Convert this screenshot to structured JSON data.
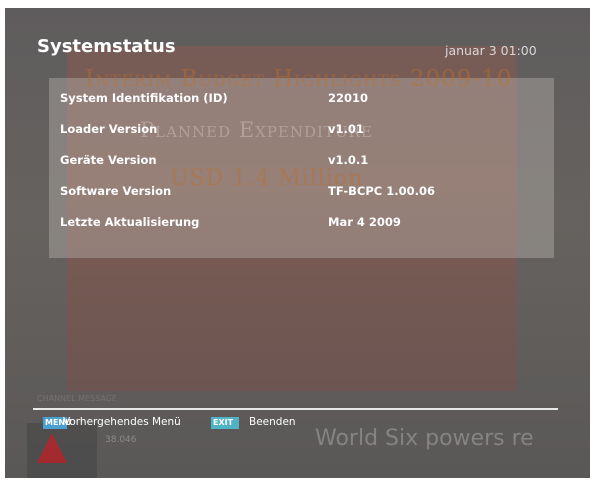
{
  "screen": {
    "title": "Systemstatus",
    "datetime": "januar 3 01:00"
  },
  "info_rows": [
    {
      "label": "System Identifikation (ID)",
      "value": "22010"
    },
    {
      "label": "Loader Version",
      "value": "v1.01"
    },
    {
      "label": "Geräte Version",
      "value": "v1.0.1"
    },
    {
      "label": "Software Version",
      "value": "TF-BCPC 1.00.06"
    },
    {
      "label": "Letzte Aktualisierung",
      "value": "Mar  4 2009"
    }
  ],
  "footer": {
    "menu_key": "MENU",
    "menu_label": "Vorhergehendes Menü",
    "exit_key": "EXIT",
    "exit_label": "Beenden"
  },
  "background": {
    "headline": "Interim Budget Highlights 2009-10",
    "line2": "Planned Expenditure",
    "line3": "USD 1.4 Million",
    "ticker": "World      Six powers re",
    "tag": "CHANNEL MESSAGE",
    "number": "38.046"
  },
  "colors": {
    "menu_key": "#4aa0cf",
    "exit_key": "#4fb2c5",
    "text": "#ffffff"
  }
}
